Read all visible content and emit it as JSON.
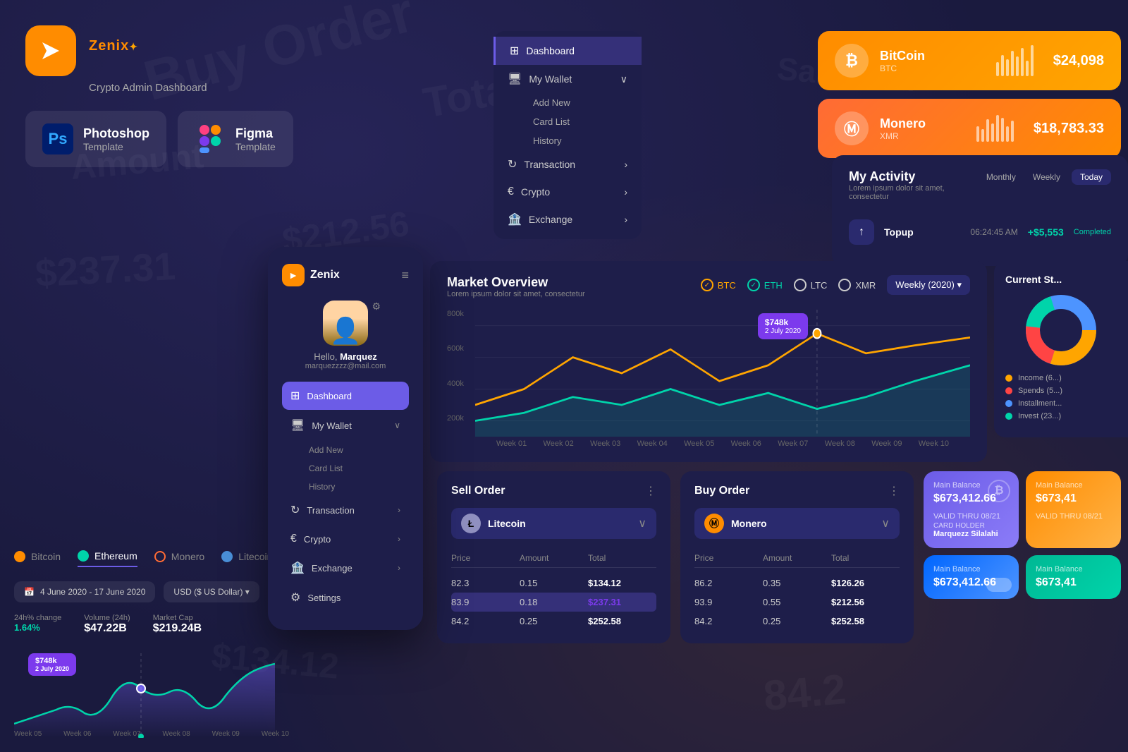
{
  "app": {
    "name": "Zenix",
    "subtitle": "Crypto Admin Dashboard",
    "logo_symbol": "►"
  },
  "templates": [
    {
      "id": "photoshop",
      "title": "Photoshop",
      "sub": "Template",
      "icon": "Ps"
    },
    {
      "id": "figma",
      "title": "Figma",
      "sub": "Template",
      "icon": "F"
    }
  ],
  "nav": {
    "items": [
      {
        "id": "dashboard",
        "label": "Dashboard",
        "icon": "⊞",
        "active": true
      },
      {
        "id": "wallet",
        "label": "My Wallet",
        "icon": "🖥",
        "has_sub": true,
        "sub_items": [
          "Add New",
          "Card List",
          "History"
        ]
      },
      {
        "id": "transaction",
        "label": "Transaction",
        "icon": "↻",
        "has_arrow": true
      },
      {
        "id": "crypto",
        "label": "Crypto",
        "icon": "€",
        "has_arrow": true
      },
      {
        "id": "exchange",
        "label": "Exchange",
        "icon": "🏦",
        "has_arrow": true
      }
    ]
  },
  "crypto_cards": [
    {
      "id": "bitcoin",
      "name": "BitCoin",
      "code": "BTC",
      "price": "$24,098",
      "icon": "B",
      "bars": [
        3,
        5,
        4,
        7,
        6,
        8,
        5,
        9
      ]
    },
    {
      "id": "monero",
      "name": "Monero",
      "code": "XMR",
      "price": "$18,783.33",
      "icon": "M",
      "bars": [
        4,
        3,
        6,
        5,
        8,
        7,
        5,
        6
      ]
    }
  ],
  "activity": {
    "title": "My Activity",
    "subtitle": "Lorem ipsum dolor sit amet, consectetur",
    "tabs": [
      "Monthly",
      "Weekly",
      "Today"
    ],
    "active_tab": "Today",
    "items": [
      {
        "label": "Topup",
        "time": "06:24:45 AM",
        "amount": "+$5,553",
        "status": "Completed",
        "icon": "↑"
      }
    ]
  },
  "market_overview": {
    "title": "Market Overview",
    "subtitle": "Lorem ipsum dolor sit amet, consectetur",
    "filters": [
      "BTC",
      "ETH",
      "LTC",
      "XMR"
    ],
    "active_filters": [
      "BTC",
      "ETH"
    ],
    "period": "Weekly (2020)",
    "x_labels": [
      "Week 01",
      "Week 02",
      "Week 03",
      "Week 04",
      "Week 05",
      "Week 06",
      "Week 07",
      "Week 08",
      "Week 09",
      "Week 10"
    ],
    "y_labels": [
      "800k",
      "600k",
      "400k",
      "200k"
    ],
    "tooltip": {
      "value": "$748k",
      "date": "2 July 2020"
    }
  },
  "orders": [
    {
      "title": "Sell Order",
      "coin": "Litecoin",
      "coin_icon": "L",
      "coin_color": "#b0b0f0",
      "rows": [
        {
          "price": "82.3",
          "amount": "0.15",
          "total": "$134.12",
          "highlight": false
        },
        {
          "price": "83.9",
          "amount": "0.18",
          "total": "$237.31",
          "highlight": true
        },
        {
          "price": "84.2",
          "amount": "0.25",
          "total": "$252.58",
          "highlight": false
        }
      ]
    },
    {
      "title": "Buy Order",
      "coin": "Monero",
      "coin_icon": "M",
      "coin_color": "#ff8c00",
      "rows": [
        {
          "price": "86.2",
          "amount": "0.35",
          "total": "$126.26",
          "highlight": false
        },
        {
          "price": "93.9",
          "amount": "0.55",
          "total": "$212.56",
          "highlight": false
        },
        {
          "price": "84.2",
          "amount": "0.25",
          "total": "$252.58",
          "highlight": false
        }
      ]
    }
  ],
  "wallet_cards": [
    {
      "label": "Main Balance",
      "amount": "$673,412.66",
      "valid": "08/21",
      "holder": "Marquezz Silalahi",
      "color": "purple",
      "icon": "B"
    },
    {
      "label": "Main Balance",
      "amount": "$673,41",
      "valid": "08/21",
      "holder": "",
      "color": "orange",
      "icon": ""
    },
    {
      "label": "Main Balance",
      "amount": "$673,412.66",
      "color": "blue",
      "icon": ""
    },
    {
      "label": "Main Balance",
      "amount": "$673,41",
      "color": "green",
      "icon": ""
    }
  ],
  "mobile": {
    "logo": "Zenix",
    "user": {
      "name": "Marquez",
      "email": "marquezzzz@mail.com"
    },
    "nav_items": [
      {
        "label": "Dashboard",
        "icon": "⊞",
        "active": true
      },
      {
        "label": "My Wallet",
        "icon": "🖥",
        "has_arrow": true
      },
      {
        "label": "Add New",
        "is_sub": true
      },
      {
        "label": "Card List",
        "is_sub": true
      },
      {
        "label": "History",
        "is_sub": true
      },
      {
        "label": "Transaction",
        "icon": "↻",
        "has_arrow": true
      },
      {
        "label": "Crypto",
        "icon": "€",
        "has_arrow": true
      },
      {
        "label": "Exchange",
        "icon": "🏦",
        "has_arrow": true
      },
      {
        "label": "Settings",
        "icon": "⚙",
        "has_arrow": false
      }
    ]
  },
  "crypto_tabs": [
    {
      "id": "bitcoin",
      "label": "Bitcoin",
      "color": "#ff8c00",
      "active": false
    },
    {
      "id": "ethereum",
      "label": "Ethereum",
      "color": "#00d4aa",
      "active": true
    },
    {
      "id": "monero",
      "label": "Monero",
      "color": "#ff6b35",
      "active": false
    },
    {
      "id": "litecoin",
      "label": "Litecoin",
      "color": "#4a90d9",
      "active": false
    }
  ],
  "bottom_stats": {
    "date_range": "4 June 2020 - 17 June 2020",
    "currency": "USD ($ US Dollar)",
    "change_24h": {
      "label": "24h% change",
      "value": "1.64%",
      "up": true
    },
    "volume_24h": {
      "label": "Volume (24h)",
      "value": "$47.22B"
    },
    "market_cap": {
      "label": "Market Cap",
      "value": "$219.24B"
    },
    "tooltip": {
      "value": "$748k",
      "date": "2 July 2020"
    }
  },
  "current_stats": {
    "title": "Current St...",
    "legend": [
      {
        "label": "Income (6...)",
        "color": "#ffa500"
      },
      {
        "label": "Spends (5...)",
        "color": "#ff4444"
      },
      {
        "label": "Installment...",
        "color": "#4d94ff"
      },
      {
        "label": "Invest (23...)",
        "color": "#00d4aa"
      }
    ]
  },
  "colors": {
    "bg_primary": "#1a1a3e",
    "bg_secondary": "#1e1e4a",
    "accent_purple": "#6c5ce7",
    "accent_orange": "#ff8c00",
    "accent_teal": "#00d4aa",
    "text_primary": "#ffffff",
    "text_muted": "#888888"
  }
}
